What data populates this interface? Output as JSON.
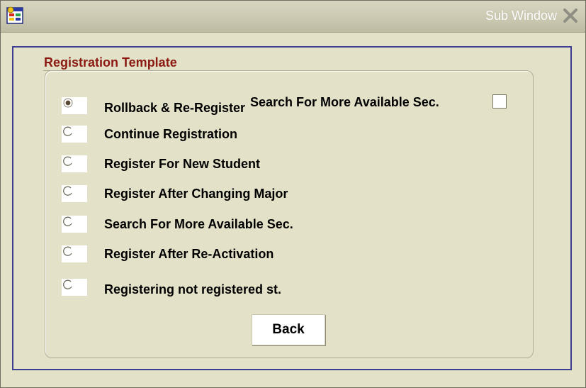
{
  "window": {
    "title": "Sub Window",
    "app_icon": "form-app-icon",
    "close_icon": "close-icon"
  },
  "group": {
    "title": "Registration Template"
  },
  "options": [
    {
      "label": "Rollback & Re-Register",
      "selected": true
    },
    {
      "label": "Continue Registration",
      "selected": false
    },
    {
      "label": "Register For New Student",
      "selected": false
    },
    {
      "label": "Register After Changing Major",
      "selected": false
    },
    {
      "label": "Search For More Available Sec.",
      "selected": false
    },
    {
      "label": "Register After Re-Activation",
      "selected": false
    },
    {
      "label": "Registering not registered st.",
      "selected": false
    }
  ],
  "search_checkbox": {
    "label": "Search For More Available Sec.",
    "checked": false
  },
  "back_button": {
    "label": "Back"
  },
  "colors": {
    "window_bg": "#e4e1c9",
    "group_title": "#8a1a12",
    "frame_border": "#3b3d93"
  }
}
